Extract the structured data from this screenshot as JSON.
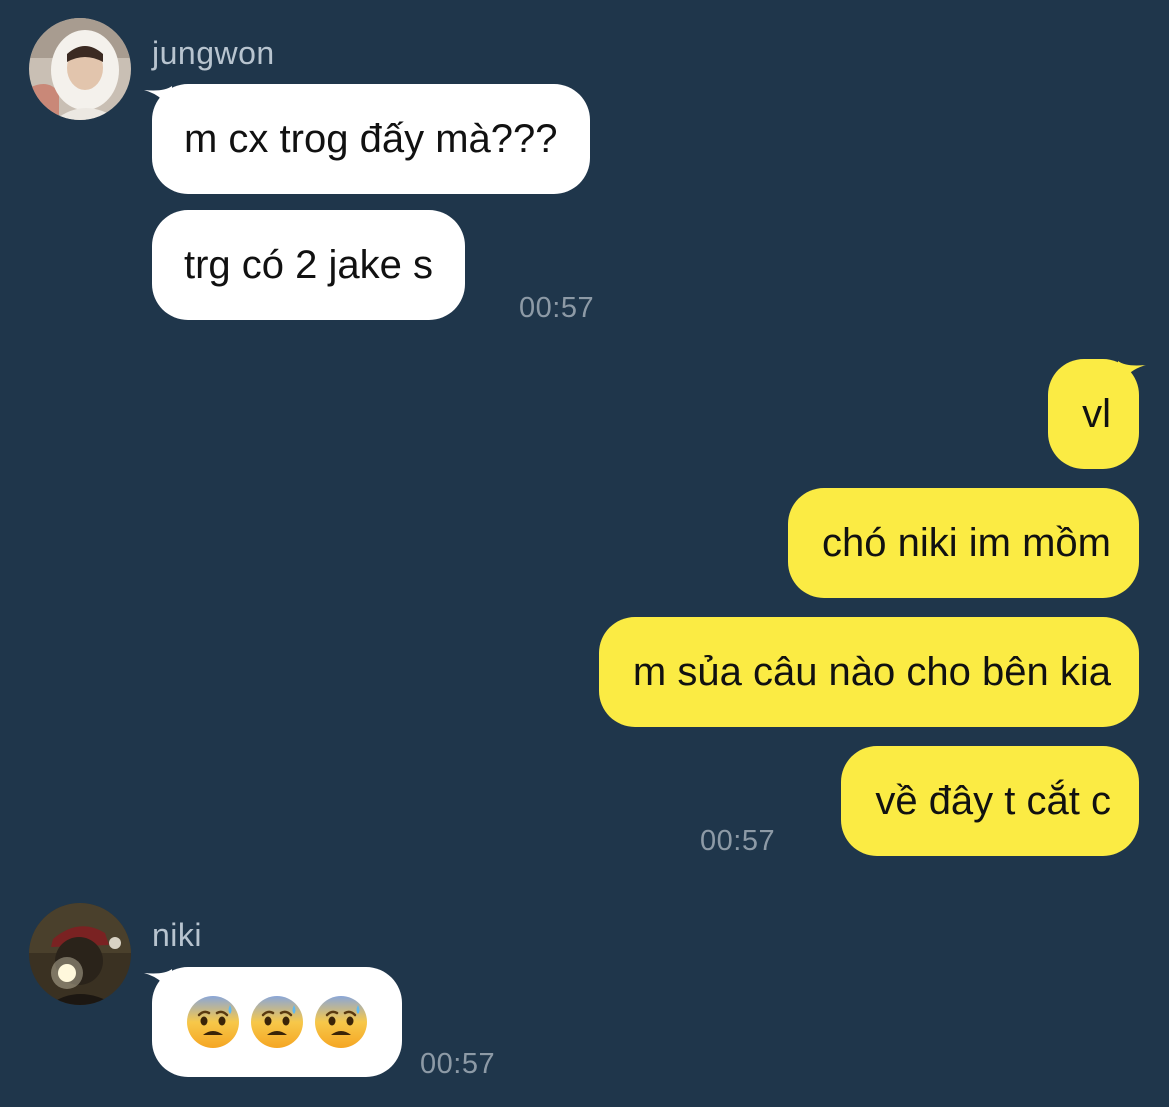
{
  "chat": {
    "group1": {
      "sender": "jungwon",
      "messages": [
        "m cx trog đấy mà???",
        "trg có 2 jake s"
      ],
      "time": "00:57"
    },
    "group2": {
      "messages": [
        "vl",
        "chó niki im mồm",
        "m sủa câu nào cho bên kia",
        "về đây t cắt c"
      ],
      "time": "00:57"
    },
    "group3": {
      "sender": "niki",
      "emojis": [
        "anxious-face-with-sweat",
        "anxious-face-with-sweat",
        "anxious-face-with-sweat"
      ],
      "time": "00:57"
    }
  },
  "colors": {
    "background": "#1f364b",
    "incoming_bubble": "#ffffff",
    "outgoing_bubble": "#fbeb44",
    "timestamp": "#8d9aa6",
    "sender_name": "#b8c4cf"
  }
}
